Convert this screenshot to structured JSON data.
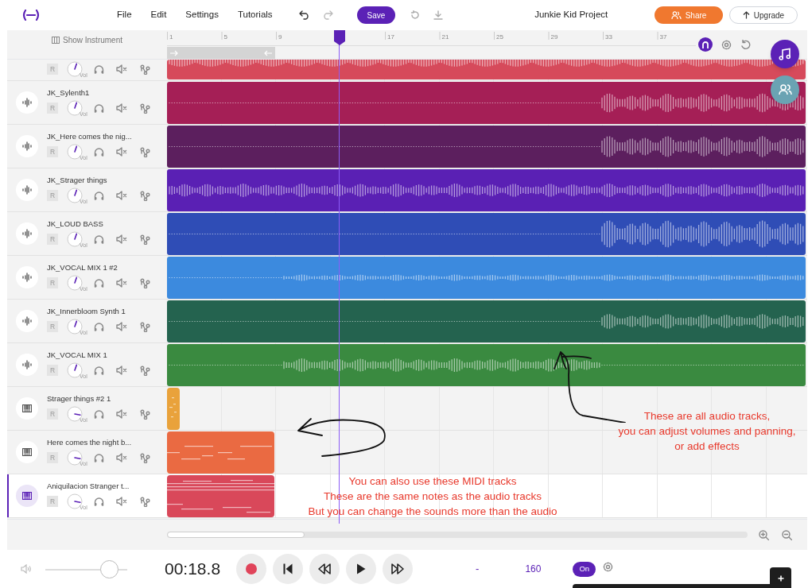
{
  "app_bar": {
    "menu": [
      "File",
      "Edit",
      "Settings",
      "Tutorials"
    ],
    "save_label": "Save",
    "project_title": "Junkie Kid Project",
    "share_label": "Share",
    "upgrade_label": "Upgrade"
  },
  "timeline": {
    "show_instrument_label": "Show Instrument",
    "ruler_labels": [
      "1",
      "5",
      "9",
      "17",
      "21",
      "25",
      "29",
      "33",
      "37"
    ]
  },
  "tracks": [
    {
      "kind": "audio",
      "record_label": "R",
      "vol_label": "Vol",
      "level": 0.57,
      "color": "#d64a5b",
      "selected": false
    },
    {
      "kind": "audio",
      "name": "JK_Sylenth1",
      "record_label": "R",
      "vol_label": "Vol",
      "level": 0.57,
      "color": "#a51f56",
      "selected": false
    },
    {
      "kind": "audio",
      "name": "JK_Here comes the nig...",
      "record_label": "R",
      "vol_label": "Vol",
      "level": 0.57,
      "color": "#5c1f5e",
      "selected": false
    },
    {
      "kind": "audio",
      "name": "JK_Strager things",
      "record_label": "R",
      "vol_label": "Vol",
      "level": 0.57,
      "color": "#5a20b4",
      "selected": false
    },
    {
      "kind": "audio",
      "name": "JK_LOUD BASS",
      "record_label": "R",
      "vol_label": "Vol",
      "level": 0.57,
      "color": "#2f4db6",
      "selected": false
    },
    {
      "kind": "audio",
      "name": "JK_VOCAL MIX 1 #2",
      "record_label": "R",
      "vol_label": "Vol",
      "level": 0.57,
      "color": "#3c8ade",
      "selected": false
    },
    {
      "kind": "audio",
      "name": "JK_Innerbloom Synth 1",
      "record_label": "R",
      "vol_label": "Vol",
      "level": 0.57,
      "color": "#24634f",
      "selected": false
    },
    {
      "kind": "audio",
      "name": "JK_VOCAL MIX 1",
      "record_label": "R",
      "vol_label": "Vol",
      "level": 0.57,
      "color": "#3a8a40",
      "selected": false
    },
    {
      "kind": "midi",
      "name": "Strager things #2 1",
      "record_label": "R",
      "vol_label": "Vol",
      "level": 0.87,
      "color": "#e9a23b",
      "selected": false
    },
    {
      "kind": "midi",
      "name": "Here comes the night b...",
      "record_label": "R",
      "vol_label": "Vol",
      "level": 0.87,
      "color": "#ea6a42",
      "selected": false
    },
    {
      "kind": "midi",
      "name": "Aniquilacion Stranger t...",
      "record_label": "R",
      "vol_label": "Vol",
      "level": 0.87,
      "color": "#d9485a",
      "selected": true
    }
  ],
  "annotations": [
    {
      "text": "These are all audio tracks,\nyou can adjust volumes and panning,\nor add effects"
    },
    {
      "text": "You can also use these MIDI tracks\nThese are the same notes as the audio tracks\nBut you can change the sounds more than the audio"
    }
  ],
  "transport": {
    "master_volume": {
      "level": 0.78
    },
    "time": "00:18.8",
    "key": "-",
    "tempo": "160",
    "metronome": {
      "label": "On",
      "on": true
    }
  }
}
